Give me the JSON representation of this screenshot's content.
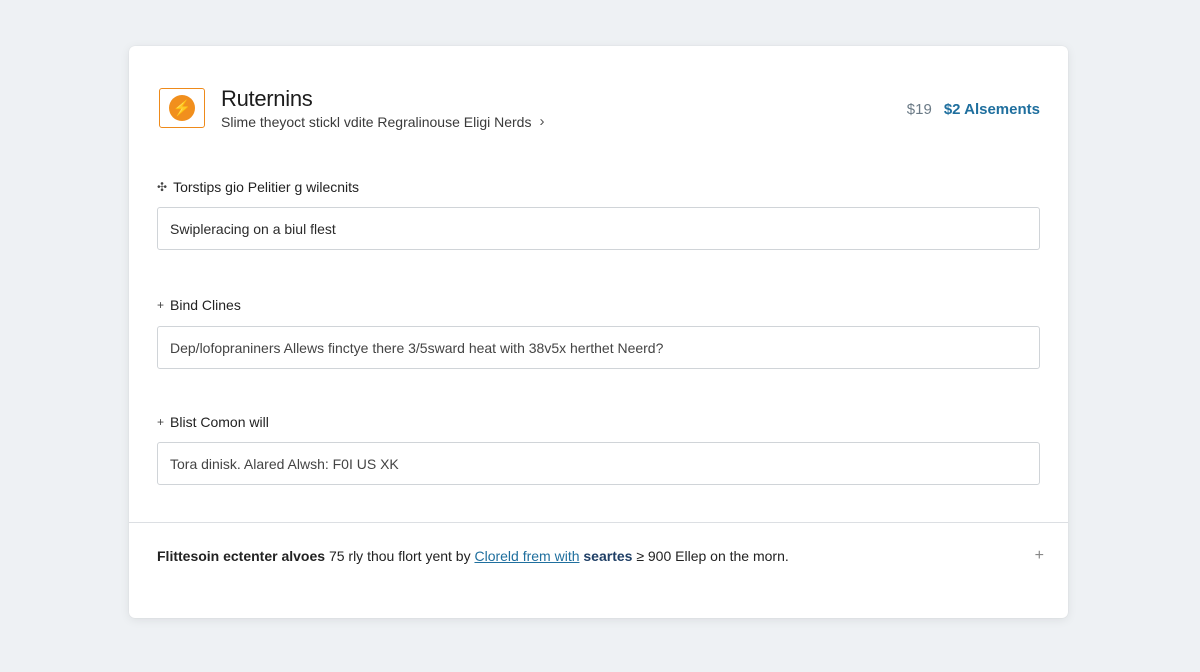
{
  "header": {
    "logo_glyph": "⚡",
    "title": "Ruternins",
    "subtitle": "Slime theyoct stickl vdite Regralinouse Eligi Nerds",
    "price": "$19",
    "assets_link": "$2 Alsements"
  },
  "sections": [
    {
      "label": "Torstips gio Pelitier g wilecnits",
      "value": "Swipleracing on a biul flest"
    },
    {
      "label": "Bind Clines",
      "value": "Dep/lofopraniners Allews finctye there 3/5sward heat with 38v5x herthet Neerd?"
    },
    {
      "label": "Blist Comon will",
      "value": "Tora dinisk. Alared Alwsh: F0I US XK"
    }
  ],
  "footer": {
    "lead": "Flittesoin ectenter alvoes",
    "text_1": " 75 rly thou flort yent by ",
    "link": "Cloreld frem with",
    "mid": " seartes",
    "text_2": " ≥ 900 Ellep on the morn."
  },
  "colors": {
    "accent": "#f18f1d",
    "link": "#1f6f9e"
  }
}
